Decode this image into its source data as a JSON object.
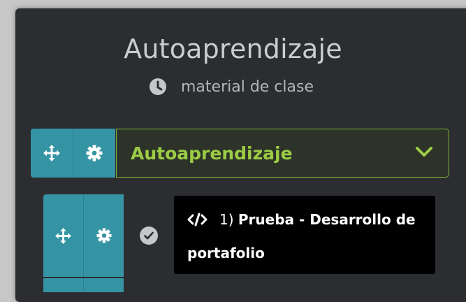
{
  "header": {
    "title": "Autoaprendizaje",
    "subtitle": "material de clase",
    "subtitle_icon": "clock-icon"
  },
  "section": {
    "label": "Autoaprendizaje",
    "move_icon": "move-arrows-icon",
    "settings_icon": "gear-icon",
    "chevron_icon": "chevron-down-icon",
    "accent_color": "#9ccc45",
    "handle_color": "#3594a4"
  },
  "items": [
    {
      "number": "1)",
      "title_line1": "Prueba - Desarrollo de",
      "title_line2": "portafolio",
      "type_icon": "code-icon",
      "status_icon": "check-circle-icon"
    }
  ]
}
